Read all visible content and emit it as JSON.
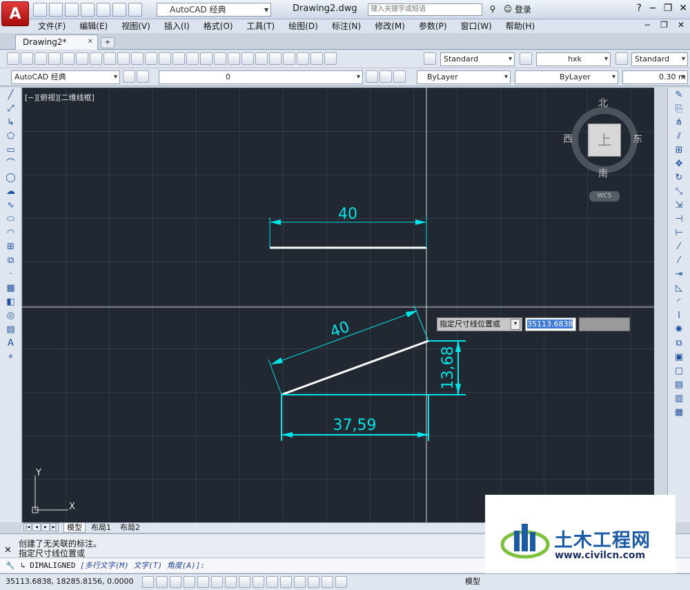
{
  "titlebar": {
    "workspace": "AutoCAD 经典",
    "document": "Drawing2.dwg",
    "search_placeholder": "键入关键字或短语",
    "login": "登录"
  },
  "menu": [
    "文件(F)",
    "编辑(E)",
    "视图(V)",
    "插入(I)",
    "格式(O)",
    "工具(T)",
    "绘图(D)",
    "标注(N)",
    "修改(M)",
    "参数(P)",
    "窗口(W)",
    "帮助(H)"
  ],
  "doc_tab": "Drawing2*",
  "toolbar1": {
    "text_style": "Standard",
    "dim_style": "hxk",
    "table_style": "Standard"
  },
  "toolbar2": {
    "workspace": "AutoCAD 经典",
    "layer": "0",
    "color": "ByLayer",
    "linetype": "ByLayer",
    "lineweight": "0.30 m"
  },
  "viewport_label": "[−][俯视][二维线框]",
  "viewcube": {
    "north": "北",
    "south": "南",
    "west": "西",
    "east": "东",
    "face": "上",
    "wcs": "WCS"
  },
  "drawing": {
    "dim_top": "40",
    "dim_aligned": "40",
    "dim_vertical": "13,68",
    "dim_horizontal": "37,59",
    "ucs_x": "X",
    "ucs_y": "Y"
  },
  "dynamic_input": {
    "prompt": "指定尺寸线位置或",
    "value": "35113.6838"
  },
  "layout_tabs": [
    "模型",
    "布局1",
    "布局2"
  ],
  "command": {
    "history1": "创建了无关联的标注。",
    "history2": "指定尺寸线位置或",
    "prompt_cmd": "DIMALIGNED",
    "opt1": "[多行文字(M)",
    "opt2": "文字(T)",
    "opt3": "角度(A)]:"
  },
  "status": {
    "coords": "35113.6838, 18285.8156, 0.0000",
    "model": "模型"
  },
  "watermark": {
    "title": "土木工程网",
    "url": "www.civilcn.com"
  },
  "colors": {
    "canvas_bg": "#212832",
    "dimension": "#00e5e5",
    "line": "#ffffff"
  }
}
